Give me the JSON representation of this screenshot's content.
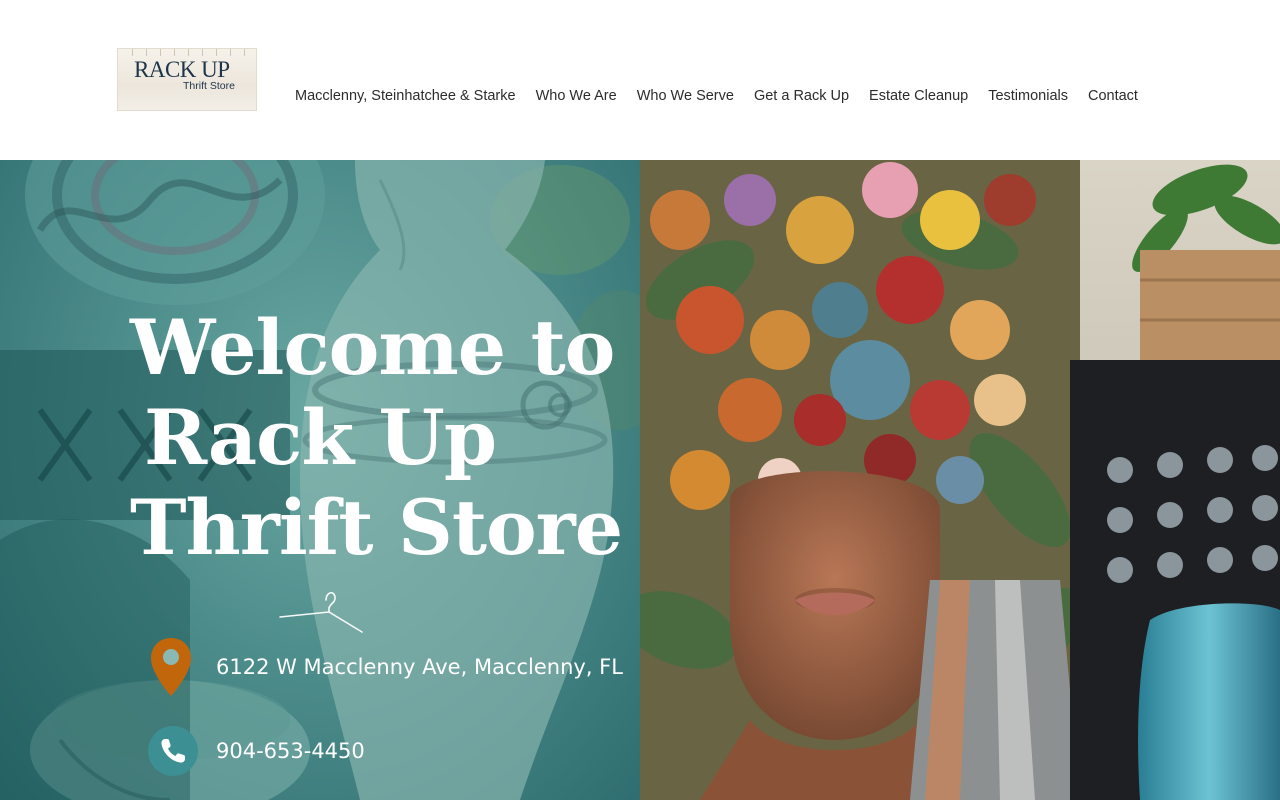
{
  "logo": {
    "title": "RACK UP",
    "subtitle": "Thrift Store"
  },
  "nav": {
    "items": [
      {
        "label": "Macclenny, Steinhatchee & Starke"
      },
      {
        "label": "Who We Are"
      },
      {
        "label": "Who We Serve"
      },
      {
        "label": "Get a Rack Up"
      },
      {
        "label": "Estate Cleanup"
      },
      {
        "label": "Testimonials"
      },
      {
        "label": "Contact"
      }
    ]
  },
  "hero": {
    "heading_line1": "Welcome to",
    "heading_line2": "Rack Up",
    "heading_line3": "Thrift Store",
    "address": "6122 W Macclenny Ave, Macclenny, FL",
    "phone": "904-653-4450"
  },
  "icons": {
    "location": "map-pin-icon",
    "phone": "phone-icon",
    "hanger": "hanger-icon"
  },
  "colors": {
    "nav_text": "#2c2c2c",
    "hero_teal": "#4d8d8b",
    "pin_orange": "#c2660b",
    "phone_teal": "#3c8f92",
    "logo_navy": "#1e3448"
  }
}
